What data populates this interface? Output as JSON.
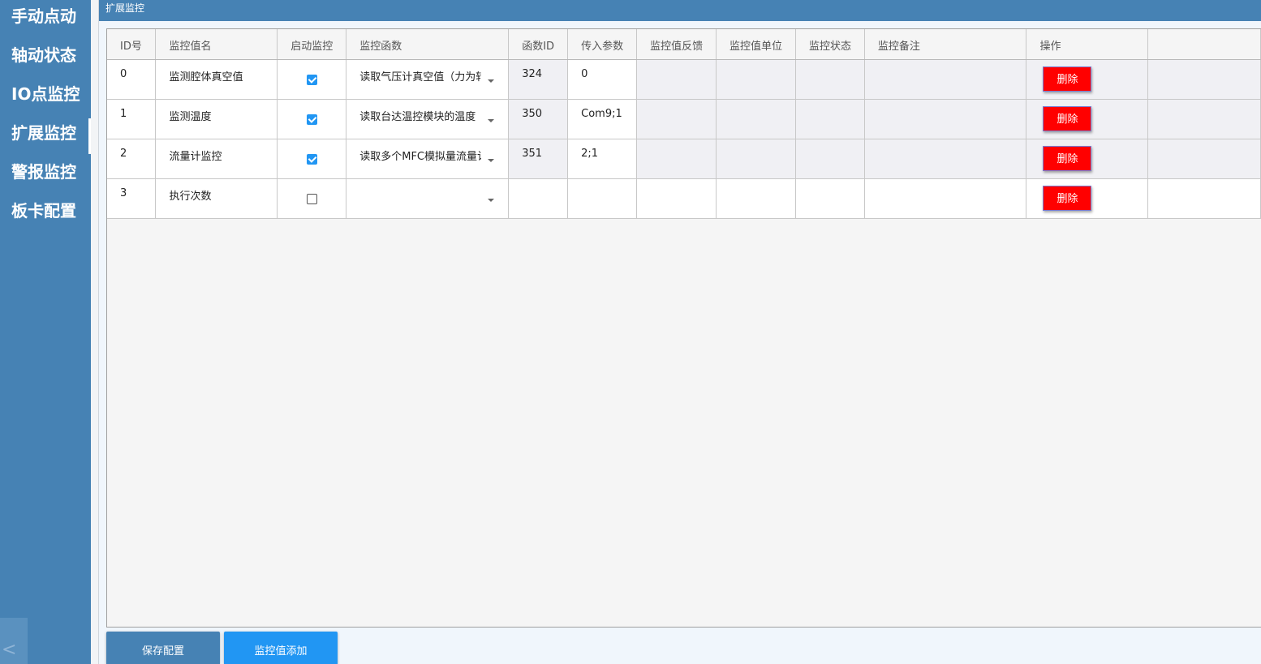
{
  "sidebar": {
    "items": [
      {
        "label": "手动点动"
      },
      {
        "label": "轴动状态"
      },
      {
        "label": "IO点监控"
      },
      {
        "label": "扩展监控"
      },
      {
        "label": "警报监控"
      },
      {
        "label": "板卡配置"
      }
    ],
    "active_index": 3,
    "collapse_label": "<"
  },
  "titlebar": {
    "title": "扩展监控"
  },
  "table": {
    "columns": [
      "ID号",
      "监控值名",
      "启动监控",
      "监控函数",
      "函数ID",
      "传入参数",
      "监控值反馈",
      "监控值单位",
      "监控状态",
      "监控备注",
      "操作",
      ""
    ],
    "rows": [
      {
        "id": "0",
        "name": "监测腔体真空值",
        "enabled": true,
        "func": "读取气压计真空值（力为转",
        "func_id": "324",
        "params": "0",
        "feedback": "",
        "unit": "",
        "status": "",
        "remark": "",
        "action": "删除"
      },
      {
        "id": "1",
        "name": "监测温度",
        "enabled": true,
        "func": "读取台达温控模块的温度",
        "func_id": "350",
        "params": "Com9;1",
        "feedback": "",
        "unit": "",
        "status": "",
        "remark": "",
        "action": "删除"
      },
      {
        "id": "2",
        "name": "流量计监控",
        "enabled": true,
        "func": "读取多个MFC模拟量流量计",
        "func_id": "351",
        "params": "2;1",
        "feedback": "",
        "unit": "",
        "status": "",
        "remark": "",
        "action": "删除"
      },
      {
        "id": "3",
        "name": "执行次数",
        "enabled": false,
        "func": "",
        "func_id": "",
        "params": "",
        "feedback": "",
        "unit": "",
        "status": "",
        "remark": "",
        "action": "删除"
      }
    ]
  },
  "footer": {
    "save_label": "保存配置",
    "add_label": "监控值添加"
  },
  "colors": {
    "sidebar_bg": "#4682b4",
    "delete_button": "#ff0000",
    "add_button": "#2196f3",
    "checkbox_checked": "#2196f3"
  }
}
